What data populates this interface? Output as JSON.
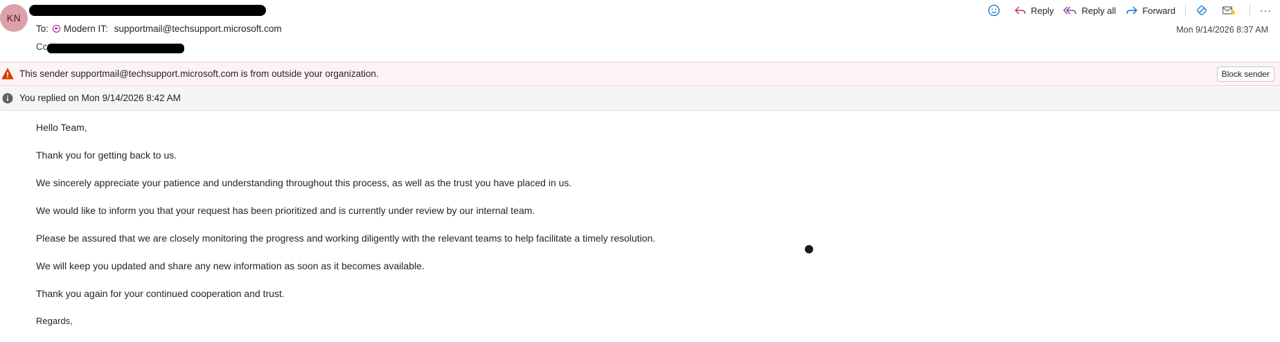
{
  "sender": {
    "initials": "KN",
    "avatar_color": "#dba1ab"
  },
  "recipients": {
    "to_label": "To:",
    "to_group": "Modern IT:",
    "to_address": "supportmail@techsupport.microsoft.com",
    "cc_label": "Cc"
  },
  "toolbar": {
    "reply_label": "Reply",
    "reply_all_label": "Reply all",
    "forward_label": "Forward",
    "more_label": "···"
  },
  "date": "Mon 9/14/2026 8:37 AM",
  "warning": {
    "text": "This sender supportmail@techsupport.microsoft.com is from outside your organization.",
    "block_label": "Block sender"
  },
  "info": {
    "text": "You replied on Mon 9/14/2026 8:42 AM"
  },
  "body": {
    "paragraphs": [
      "Hello Team,",
      "Thank you for getting back to us.",
      "We sincerely appreciate your patience and understanding throughout this process, as well as the trust you have placed in us.",
      "We would like to inform you that your request has been prioritized and is currently under review by our internal team.",
      "Please be assured that we are closely monitoring the progress and working diligently with the relevant teams to help facilitate a timely resolution.",
      "We will keep you updated and share any new information as soon as it becomes available.",
      "Thank you again for your continued cooperation and trust.",
      "Regards,"
    ]
  },
  "colors": {
    "accent": "#0f6cbd",
    "warning": "#c4314b",
    "group": "#b4009e"
  }
}
